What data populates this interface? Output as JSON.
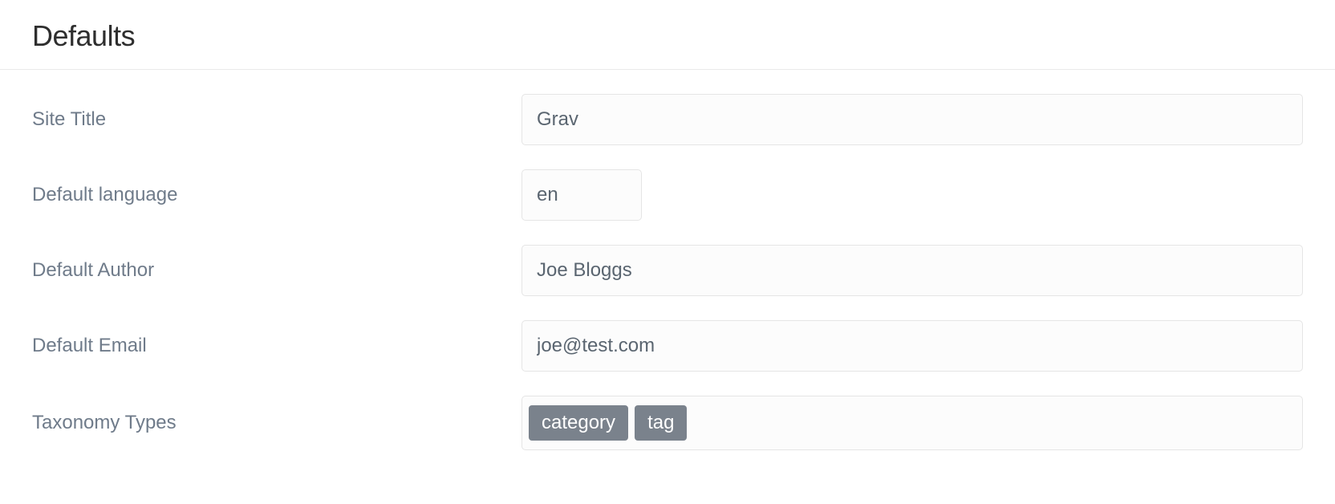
{
  "section": {
    "title": "Defaults"
  },
  "fields": {
    "site_title": {
      "label": "Site Title",
      "value": "Grav"
    },
    "default_language": {
      "label": "Default language",
      "value": "en"
    },
    "default_author": {
      "label": "Default Author",
      "value": "Joe Bloggs"
    },
    "default_email": {
      "label": "Default Email",
      "value": "joe@test.com"
    },
    "taxonomy_types": {
      "label": "Taxonomy Types",
      "tags": [
        "category",
        "tag"
      ]
    }
  }
}
